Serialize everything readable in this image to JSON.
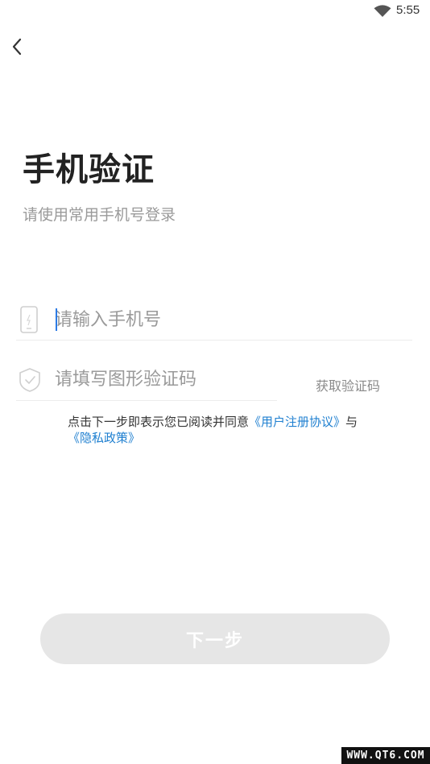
{
  "status_bar": {
    "time": "5:55",
    "wifi_icon": "wifi-icon"
  },
  "nav": {
    "back_icon": "chevron-left-icon"
  },
  "header": {
    "title": "手机验证",
    "subtitle": "请使用常用手机号登录"
  },
  "form": {
    "phone": {
      "icon": "phone-icon",
      "value": "",
      "placeholder": "请输入手机号"
    },
    "captcha": {
      "icon": "shield-icon",
      "value": "",
      "placeholder": "请填写图形验证码"
    },
    "get_code_label": "获取验证码"
  },
  "agreement": {
    "prefix": "点击下一步即表示您已阅读并同意",
    "user_agreement": "《用户注册协议》",
    "conjunction": "与",
    "privacy_policy": "《隐私政策》"
  },
  "actions": {
    "next_label": "下一步"
  },
  "watermark": {
    "text": "WWW.QT6.COM"
  },
  "colors": {
    "link": "#1e7fd0",
    "button_disabled": "#e6e6e6",
    "placeholder": "#9a9a9a",
    "caret": "#2c7be5"
  }
}
